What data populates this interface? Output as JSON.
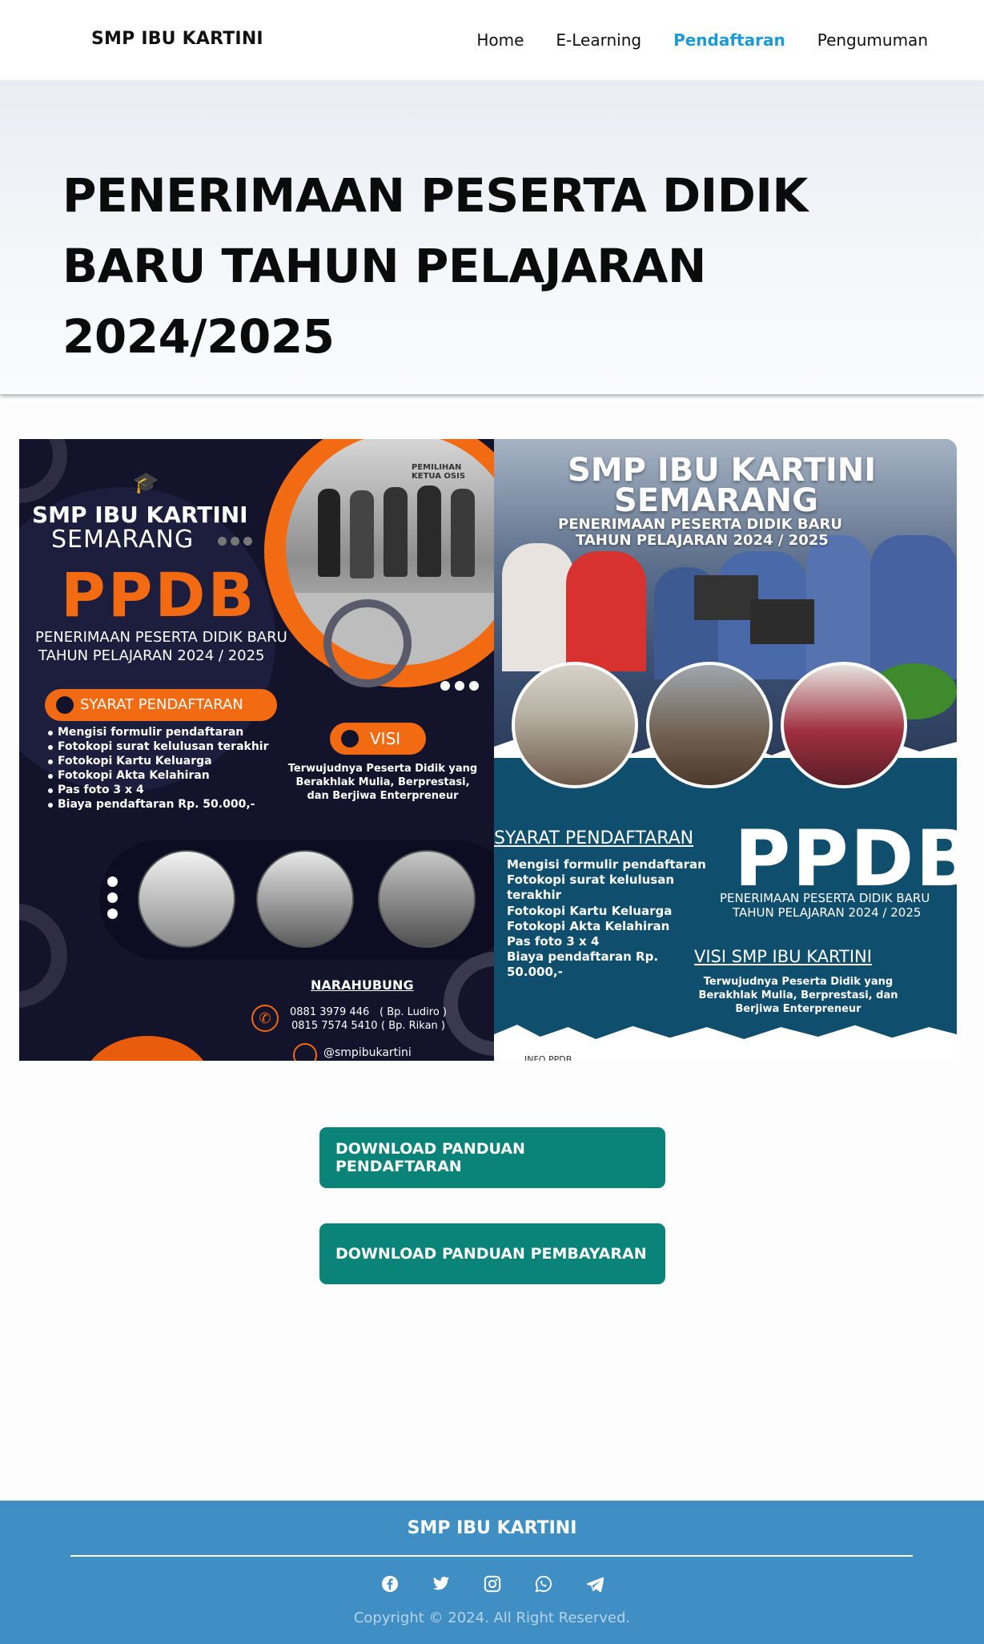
{
  "nav": {
    "brand": "SMP IBU KARTINI",
    "items": [
      {
        "label": "Home",
        "active": false
      },
      {
        "label": "E-Learning",
        "active": false
      },
      {
        "label": "Pendaftaran",
        "active": true
      },
      {
        "label": "Pengumuman",
        "active": false
      }
    ]
  },
  "hero": {
    "title": "PENERIMAAN PESERTA DIDIK BARU TAHUN PELAJARAN 2024/2025"
  },
  "poster_left": {
    "school": "SMP IBU KARTINI",
    "city": "SEMARANG",
    "ppdb": "PPDB",
    "subtitle_1": "PENERIMAAN PESERTA DIDIK BARU",
    "subtitle_2": "TAHUN PELAJARAN 2024 / 2025",
    "syarat_heading": "SYARAT PENDAFTARAN",
    "syarat": [
      "Mengisi formulir pendaftaran",
      "Fotokopi surat kelulusan terakhir",
      "Fotokopi Kartu Keluarga",
      "Fotokopi Akta Kelahiran",
      "Pas foto 3 x 4",
      "Biaya pendaftaran Rp. 50.000,-"
    ],
    "visi_heading": "VISI",
    "visi_1": "Terwujudnya Peserta Didik yang",
    "visi_2": "Berakhlak Mulia, Berprestasi,",
    "visi_3": "dan Berjiwa Enterpreneur",
    "contact_heading": "NARAHUBUNG",
    "phone_1": "0881 3979 446",
    "person_1": "( Bp. Ludiro )",
    "phone_2": "0815 7574 5410",
    "person_2": "( Bp. Rikan )",
    "instagram": "@smpibukartini",
    "photo_sign": "PEMILIHAN KETUA OSIS"
  },
  "poster_right": {
    "school": "SMP IBU KARTINI",
    "city": "SEMARANG",
    "subtitle_1": "PENERIMAAN PESERTA DIDIK BARU",
    "subtitle_2": "TAHUN PELAJARAN 2024 / 2025",
    "syarat_heading": "SYARAT PENDAFTARAN",
    "syarat": [
      "Mengisi formulir pendaftaran",
      "Fotokopi surat kelulusan terakhir",
      "Fotokopi Kartu Keluarga",
      "Fotokopi Akta Kelahiran",
      "Pas foto 3 x 4",
      "Biaya pendaftaran Rp. 50.000,-"
    ],
    "ppdb": "PPDB",
    "ppdb_sub_1": "PENERIMAAN PESERTA DIDIK BARU",
    "ppdb_sub_2": "TAHUN PELAJARAN 2024 / 2025",
    "visi_heading": "VISI SMP IBU KARTINI",
    "visi_1": "Terwujudnya Peserta Didik yang",
    "visi_2": "Berakhlak Mulia, Berprestasi, dan",
    "visi_3": "Berjiwa Enterpreneur",
    "footer_note": "INFO PPDB"
  },
  "buttons": {
    "panduan_pendaftaran": "DOWNLOAD PANDUAN PENDAFTARAN",
    "panduan_pembayaran": "DOWNLOAD PANDUAN PEMBAYARAN"
  },
  "footer": {
    "title": "SMP IBU KARTINI",
    "socials": [
      "facebook-icon",
      "twitter-icon",
      "instagram-icon",
      "whatsapp-icon",
      "telegram-icon"
    ],
    "copyright": "Copyright © 2024. All Right Reserved."
  },
  "colors": {
    "accent_nav": "#1a9ad6",
    "button": "#0a8378",
    "footer": "#3f8fc4",
    "poster_orange": "#f26a12",
    "poster_left_bg": "#14132c",
    "poster_right_bg": "#0f4e6d"
  }
}
